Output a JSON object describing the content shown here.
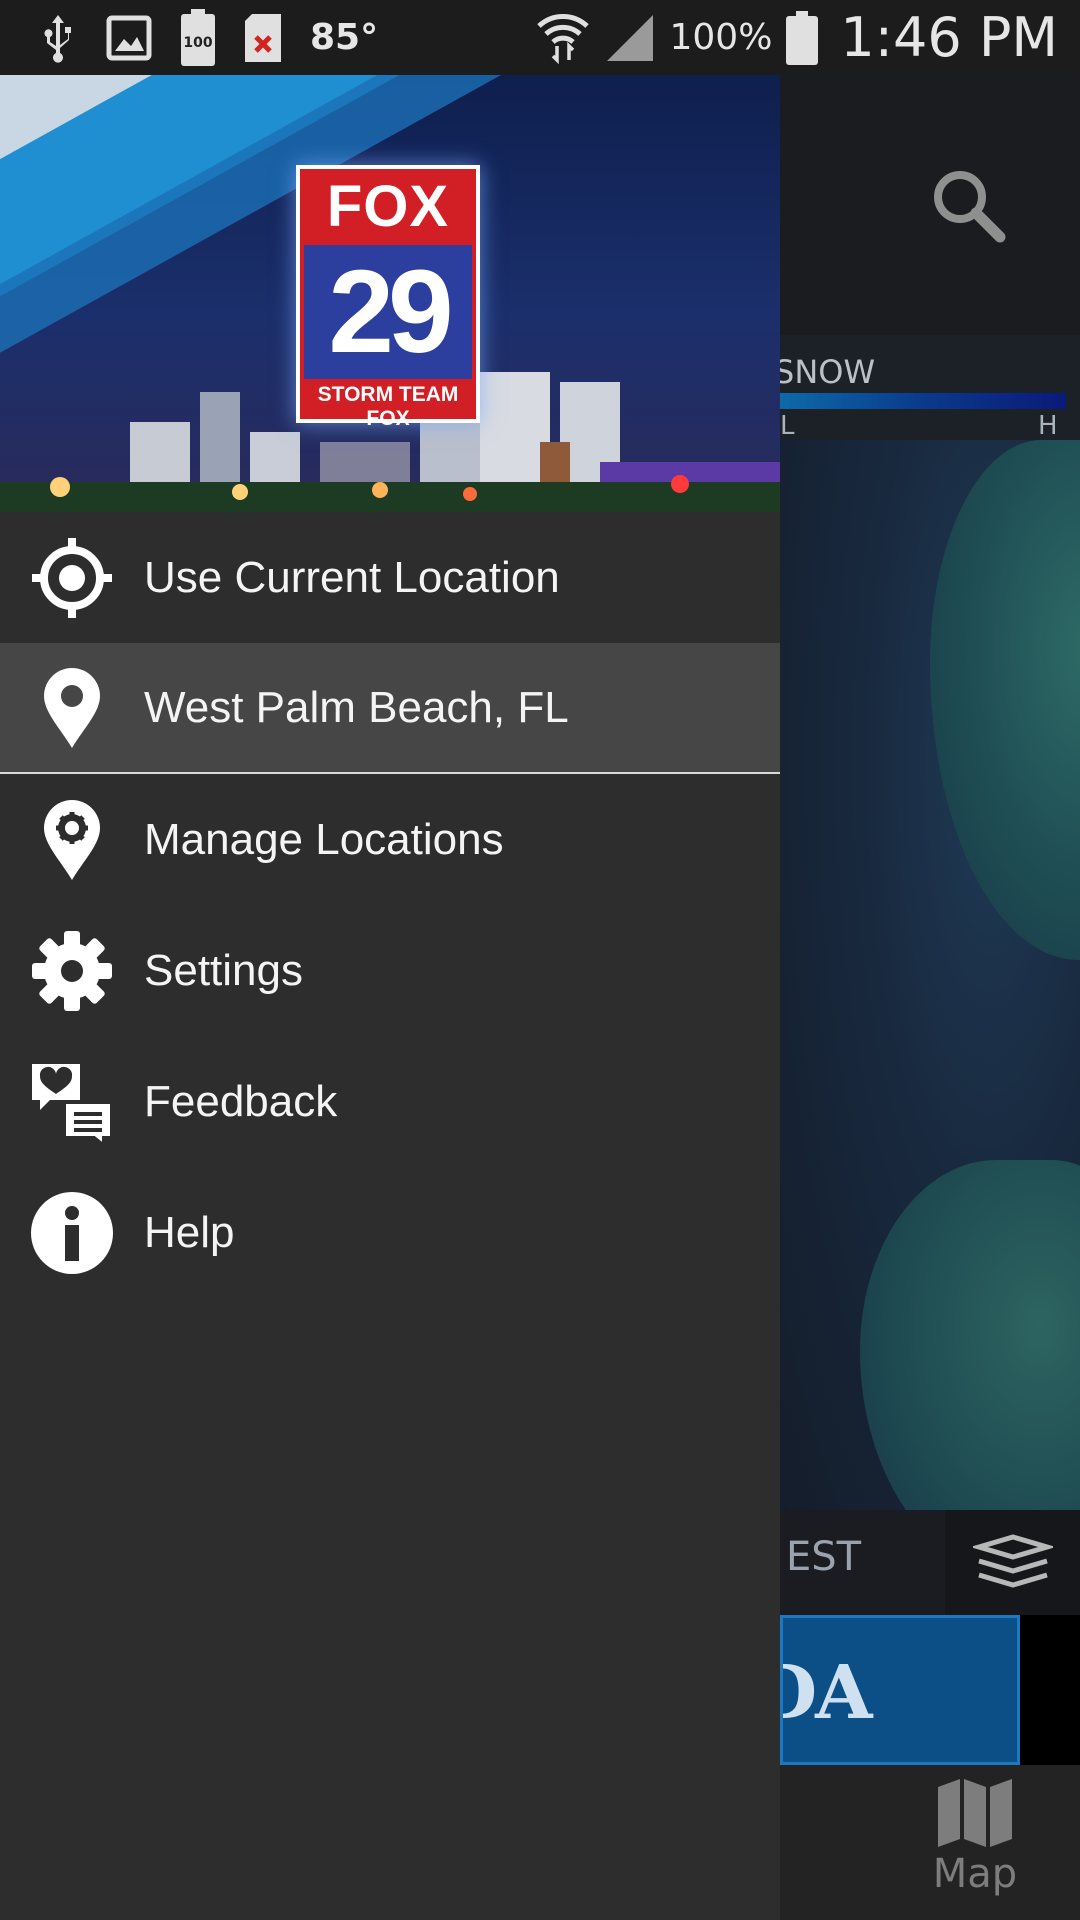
{
  "status_bar": {
    "icons_left": [
      "usb-icon",
      "image-icon",
      "battery-100-icon",
      "sd-card-error-icon"
    ],
    "temperature": "85°",
    "battery_percent": "100%",
    "time": "1:46 PM",
    "icons_right": [
      "wifi-icon",
      "signal-icon",
      "battery-icon"
    ]
  },
  "drawer": {
    "logo": {
      "brand": "FOX",
      "channel": "29",
      "tagline": "STORM TEAM FOX"
    },
    "menu": [
      {
        "label": "Use Current Location",
        "icon": "crosshair-location-icon"
      },
      {
        "label": "West Palm Beach, FL",
        "icon": "map-pin-icon",
        "selected": true
      },
      {
        "label": "Manage Locations",
        "icon": "pin-gear-icon"
      },
      {
        "label": "Settings",
        "icon": "gear-icon"
      },
      {
        "label": "Feedback",
        "icon": "feedback-icon"
      },
      {
        "label": "Help",
        "icon": "info-icon"
      }
    ]
  },
  "background_app": {
    "legend_label": "SNOW",
    "legend_low": "L",
    "legend_high": "H",
    "forecast_label": "EST",
    "ad_text": "DA",
    "bottom_tab_label": "Map",
    "colors": {
      "drawer_bg": "#2d2d2d",
      "selected_bg": "#464646",
      "status_bar_bg": "#1c1c1c"
    }
  }
}
